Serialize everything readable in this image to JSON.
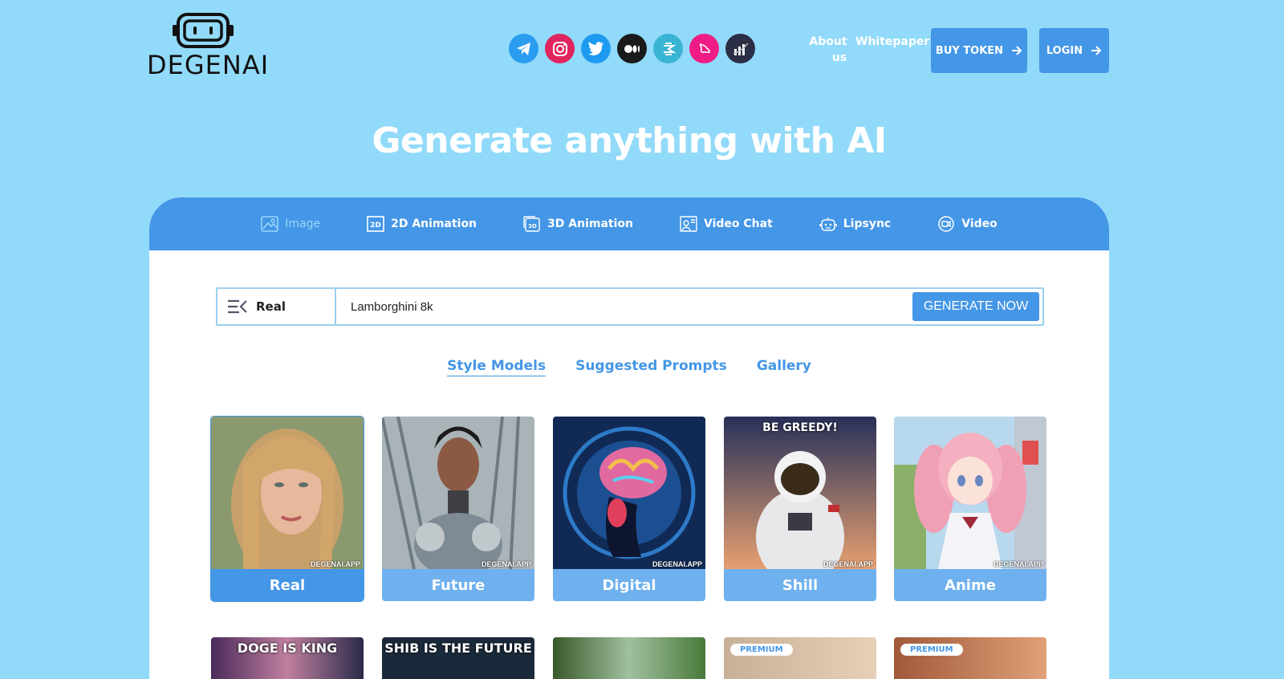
{
  "brand": {
    "name": "DEGENAI"
  },
  "socials": [
    {
      "name": "telegram-icon",
      "color": "#229ED9"
    },
    {
      "name": "instagram-icon",
      "color": "#E1306C"
    },
    {
      "name": "twitter-icon",
      "color": "#1DA1F2"
    },
    {
      "name": "medium-icon",
      "color": "#111111"
    },
    {
      "name": "dextools-icon",
      "color": "#3bb7d3"
    },
    {
      "name": "uniswap-icon",
      "color": "#FF007A"
    },
    {
      "name": "coinmarketcap-icon",
      "color": "#333344"
    }
  ],
  "nav": {
    "about_line1": "About",
    "about_line2": "us",
    "whitepaper": "Whitepaper",
    "buy_token": "BUY TOKEN",
    "login": "LOGIN"
  },
  "hero": {
    "title": "Generate anything with AI"
  },
  "tabs": [
    {
      "label": "Image",
      "icon": "image-icon",
      "active": true
    },
    {
      "label": "2D Animation",
      "icon": "2d-icon"
    },
    {
      "label": "3D Animation",
      "icon": "3d-icon"
    },
    {
      "label": "Video Chat",
      "icon": "video-chat-icon"
    },
    {
      "label": "Lipsync",
      "icon": "robot-icon"
    },
    {
      "label": "Video",
      "icon": "video-icon"
    }
  ],
  "search": {
    "model": "Real",
    "value": "Lamborghini 8k",
    "button": "GENERATE NOW"
  },
  "subtabs": [
    {
      "label": "Style Models",
      "active": true
    },
    {
      "label": "Suggested Prompts"
    },
    {
      "label": "Gallery"
    }
  ],
  "watermark": "DEGENAI.APP",
  "models": [
    {
      "label": "Real",
      "selected": true,
      "banner": ""
    },
    {
      "label": "Future",
      "banner": ""
    },
    {
      "label": "Digital",
      "banner": ""
    },
    {
      "label": "Shill",
      "banner": "BE GREEDY!"
    },
    {
      "label": "Anime",
      "banner": ""
    }
  ],
  "row2": [
    {
      "text": "DOGE IS KING"
    },
    {
      "text": "SHIB IS THE FUTURE"
    },
    {
      "text": ""
    },
    {
      "text": "",
      "badge": "PREMIUM"
    },
    {
      "text": "",
      "badge": "PREMIUM"
    }
  ],
  "colors": {
    "accent": "#4496e6",
    "background": "#92daf9",
    "tab_active": "#9ad7fa"
  }
}
